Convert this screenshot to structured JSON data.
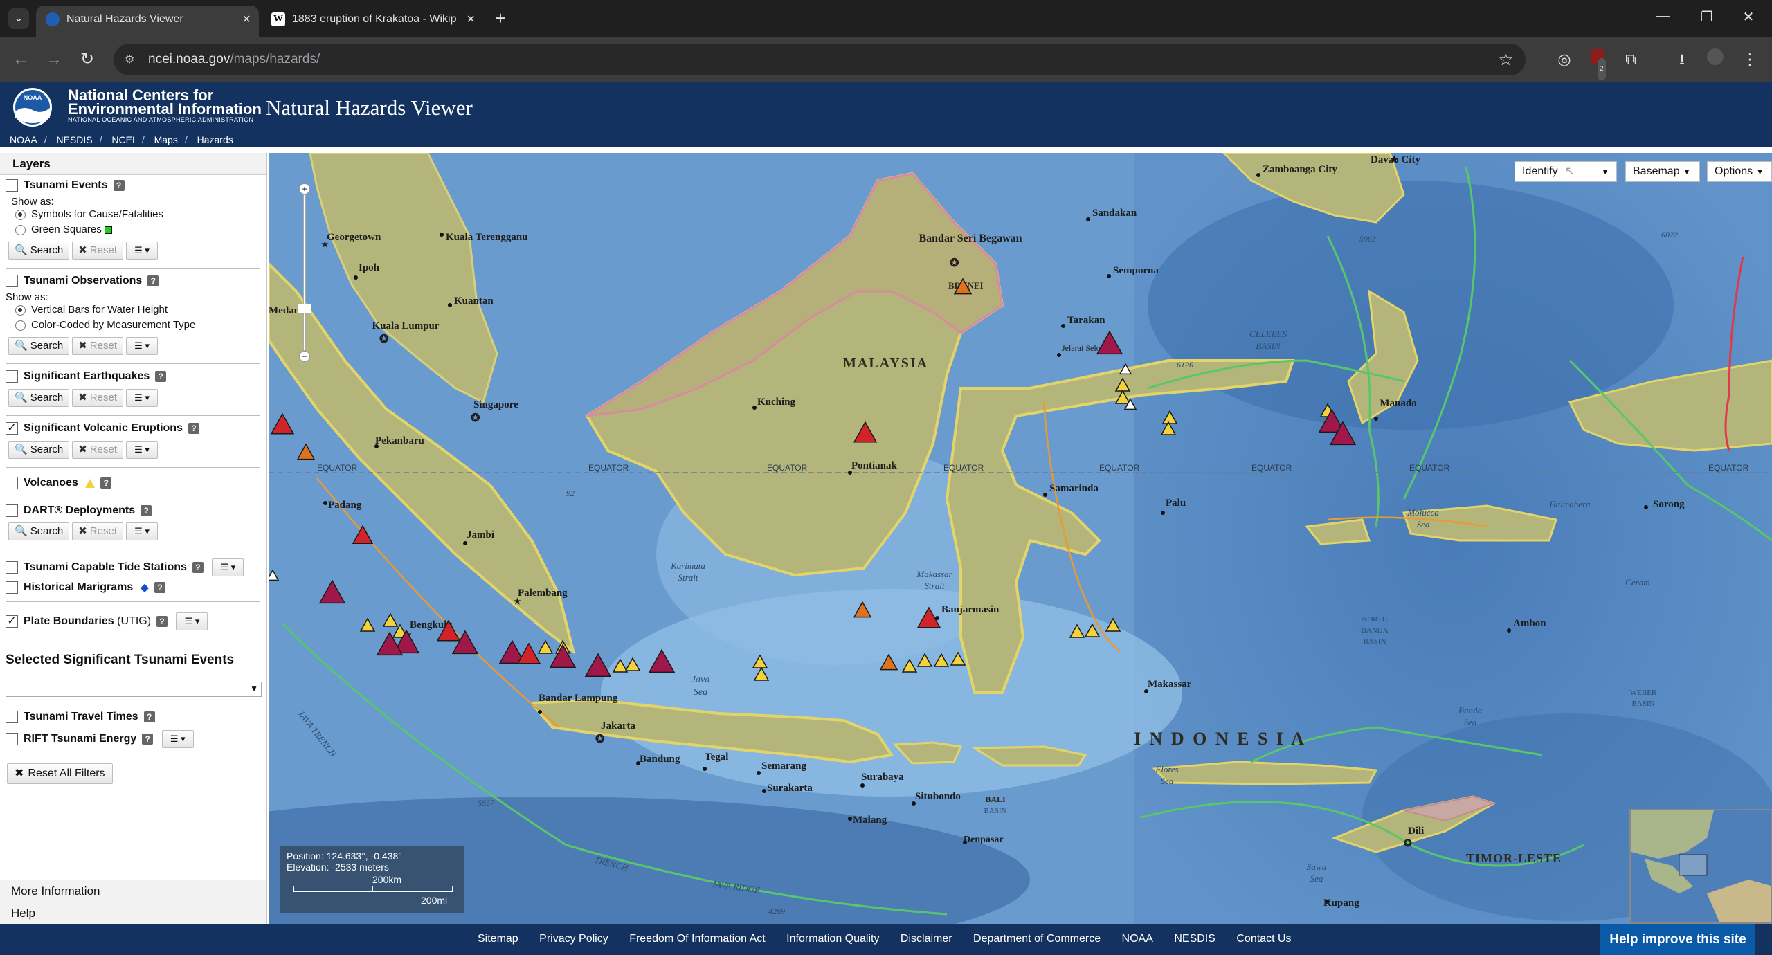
{
  "browser": {
    "tabs": [
      {
        "title": "Natural Hazards Viewer",
        "active": true
      },
      {
        "title": "1883 eruption of Krakatoa - Wikip",
        "active": false
      }
    ],
    "url_host": "ncei.noaa.gov",
    "url_path": "/maps/hazards/",
    "extension_badge": "2"
  },
  "header": {
    "org_line1": "National Centers for",
    "org_line2": "Environmental Information",
    "org_sub": "NATIONAL OCEANIC AND ATMOSPHERIC ADMINISTRATION",
    "logo_text": "NOAA",
    "app_title": "Natural Hazards Viewer",
    "breadcrumb": [
      "NOAA",
      "NESDIS",
      "NCEI",
      "Maps",
      "Hazards"
    ]
  },
  "panel": {
    "title": "Layers",
    "show_as": "Show as:",
    "search": "Search",
    "reset": "Reset",
    "layers": {
      "tsunami_events": {
        "label": "Tsunami Events",
        "checked": false,
        "options": [
          "Symbols for Cause/Fatalities",
          "Green Squares"
        ],
        "selected": 0
      },
      "tsunami_obs": {
        "label": "Tsunami Observations",
        "checked": false,
        "options": [
          "Vertical Bars for Water Height",
          "Color-Coded by Measurement Type"
        ],
        "selected": 0
      },
      "earthquakes": {
        "label": "Significant Earthquakes",
        "checked": false
      },
      "volcanic": {
        "label": "Significant Volcanic Eruptions",
        "checked": true
      },
      "volcanoes": {
        "label": "Volcanoes",
        "checked": false
      },
      "dart": {
        "label": "DART® Deployments",
        "checked": false
      },
      "tide": {
        "label": "Tsunami Capable Tide Stations",
        "checked": false
      },
      "marigrams": {
        "label": "Historical Marigrams",
        "checked": false
      },
      "plates": {
        "label": "Plate Boundaries",
        "suffix": "(UTIG)",
        "checked": true
      },
      "travel": {
        "label": "Tsunami Travel Times",
        "checked": false
      },
      "rift": {
        "label": "RIFT Tsunami Energy",
        "checked": false
      }
    },
    "selected_events_title": "Selected Significant Tsunami Events",
    "reset_all": "Reset All Filters",
    "more_info": "More Information",
    "help": "Help"
  },
  "map": {
    "menus": {
      "identify": "Identify",
      "basemap": "Basemap",
      "options": "Options"
    },
    "position": "Position: 124.633°, -0.438°",
    "elevation": "Elevation: -2533 meters",
    "scale_km": "200km",
    "scale_mi": "200mi",
    "equator_label": "EQUATOR",
    "labels": {
      "malaysia": "MALAYSIA",
      "indonesia": "I N D O N E S I A",
      "brunei": "BRUNEI",
      "timor": "TIMOR-LESTE",
      "bali": "BALI",
      "celebes": "CELEBES",
      "basin": "BASIN",
      "java_sea1": "Java",
      "java_sea2": "Sea",
      "karimata1": "Karimata",
      "karimata2": "Strait",
      "makassar1": "Makassar",
      "makassar2": "Strait",
      "molucca1": "Molucca",
      "molucca2": "Sea",
      "halmahera": "Halmahera",
      "flores1": "Flores",
      "flores2": "Sea",
      "banda1": "Banda",
      "banda2": "Sea",
      "sawu1": "Sawu",
      "sawu2": "Sea",
      "ceram": "Ceram",
      "nbb1": "NORTH",
      "nbb2": "BANDA",
      "nbb3": "BASIN",
      "weber1": "WEBER",
      "weber2": "BASIN",
      "javatrench": "JAVA TRENCH",
      "javaridge": "JAVA RIDGE",
      "trench2": "TRENCH"
    },
    "cities": [
      "Zamboanga City",
      "Davao City",
      "Sandakan",
      "Bandar Seri Begawan",
      "Semporna",
      "Tarakan",
      "Kuala Terengganu",
      "Georgetown",
      "Ipoh",
      "Kuantan",
      "Kuala Lumpur",
      "Singapore",
      "Kuching",
      "Manado",
      "Pekanbaru",
      "Padang",
      "Pontianak",
      "Samarinda",
      "Palu",
      "Sorong",
      "Jambi",
      "Palembang",
      "Bengkulu",
      "Banjarmasin",
      "Ambon",
      "Makassar",
      "Bandar Lampung",
      "Jakarta",
      "Bandung",
      "Tegal",
      "Semarang",
      "Surakarta",
      "Surabaya",
      "Situbondo",
      "Malang",
      "Denpasar",
      "Dili",
      "Kupang",
      "Jelarai Selor",
      "Medan"
    ],
    "depths": [
      "92",
      "6126",
      "5963",
      "6022",
      "5857",
      "4269"
    ]
  },
  "footer": {
    "links": [
      "Sitemap",
      "Privacy Policy",
      "Freedom Of Information Act",
      "Information Quality",
      "Disclaimer",
      "Department of Commerce",
      "NOAA",
      "NESDIS",
      "Contact Us"
    ],
    "help_improve": "Help improve this site"
  },
  "colors": {
    "header_bg": "#14325f",
    "sea": "#5d8fc7",
    "land": "#b9b77e",
    "volcano_major": "#a0174a",
    "volcano_red": "#d0242a",
    "volcano_orange": "#e0721e",
    "volcano_yellow": "#f3d23c",
    "plate_boundary": "#58c76c"
  }
}
